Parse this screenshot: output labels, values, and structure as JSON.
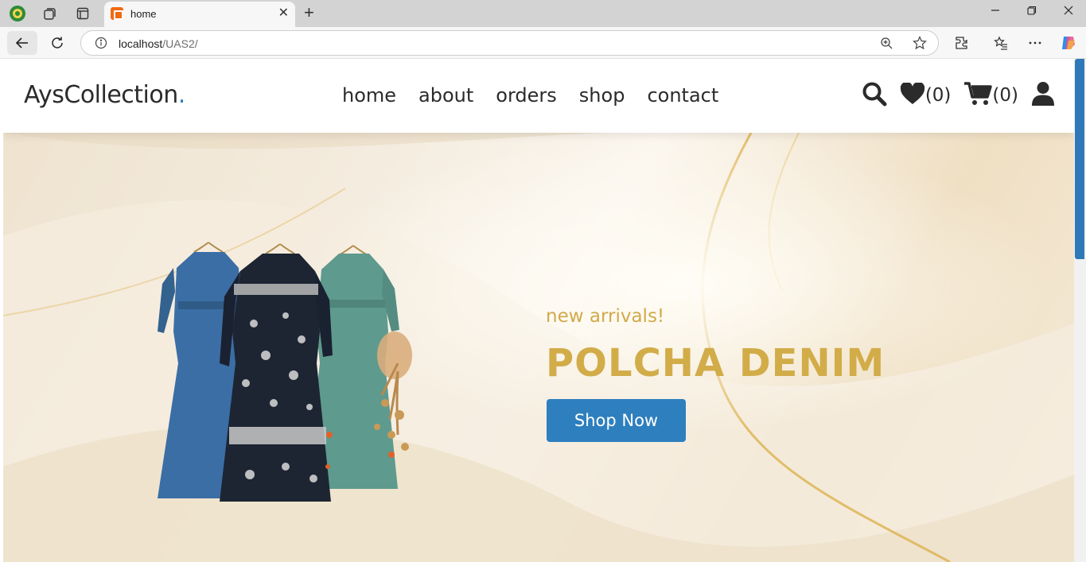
{
  "browser": {
    "tab_title": "home",
    "url_host": "localhost",
    "url_path": "/UAS2/",
    "new_tab_label": "+",
    "tab_close_label": "✕"
  },
  "site": {
    "logo_text": "AysCollection",
    "logo_dot": ".",
    "nav": [
      "home",
      "about",
      "orders",
      "shop",
      "contact"
    ],
    "wishlist_count": "(0)",
    "cart_count": "(0)"
  },
  "hero": {
    "subtitle": "new arrivals!",
    "title": "POLCHA DENIM",
    "cta_label": "Shop Now"
  },
  "colors": {
    "accent_blue": "#2d7fbe",
    "gold": "#d2ac48",
    "dress_denim": "#3b6ea5",
    "dress_dark": "#1d2533",
    "dress_sage": "#5e9a8e"
  }
}
